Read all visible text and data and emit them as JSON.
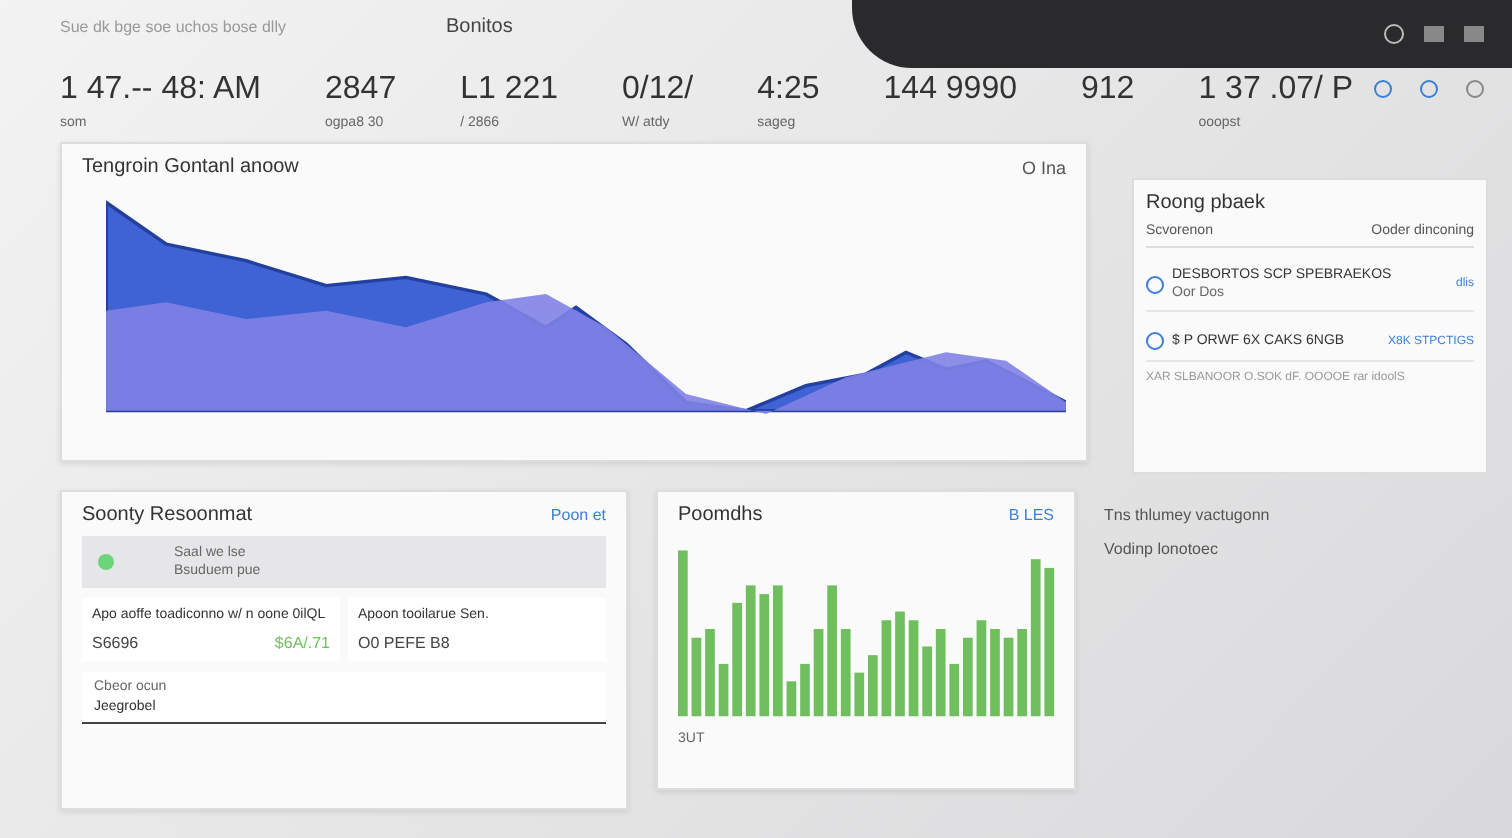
{
  "header": {
    "subtitle": "Sue dk bge soe uchos bose dlly",
    "title": "Bonitos"
  },
  "stats": [
    {
      "value": "1 47.-- 48: AM",
      "label": "som"
    },
    {
      "value": "2847",
      "label": "ogpa8 30"
    },
    {
      "value": "L1 221",
      "label": "/ 2866"
    },
    {
      "value": "0/12/",
      "label": "W/ atdy"
    },
    {
      "value": "4:25",
      "label": "sageg"
    },
    {
      "value": "144 9990"
    },
    {
      "value": "912"
    },
    {
      "value": "1 37 .07/ P",
      "label": "ooopst"
    }
  ],
  "area_card": {
    "title": "Tengroin Gontanl anoow",
    "legend": "O Ina"
  },
  "activity_panel": {
    "title": "Roong pbaek",
    "subtitle": "Scvorenon",
    "action": "Ooder dinconing",
    "rows": [
      {
        "title": "DESBORTOS SCP SPEBRAEKOS",
        "detail": "Oor Dos",
        "right": "dlis"
      },
      {
        "title": "$ P ORWF 6X CAKS 6NGB",
        "right": "X8K STPCTIGS"
      }
    ],
    "footer": "XAR SLBANOOR O.SOK dF. OOOOE rar idoolS"
  },
  "security_card": {
    "title": "Soonty Resoonmat",
    "link": "Poon et",
    "status": {
      "line1": "Saal we lse",
      "line2": "Bsuduem pue",
      "color": "#6cd47a"
    },
    "tiles": [
      {
        "text": "Apo aoffe toadiconno w/ n oone 0ilQL",
        "value": "S6696",
        "change": "$6A/.71"
      },
      {
        "text": "Apoon tooilarue Sen.",
        "value": "O0 PEFE B8"
      }
    ],
    "input": {
      "label": "Cbeor ocun",
      "value": "Jeegrobel"
    }
  },
  "bar_card": {
    "title": "Poomdhs",
    "action": "B LES",
    "footer": "3UT"
  },
  "notes": [
    "Tns thlumey vactugonn",
    "Vodinp lonotoec"
  ]
}
